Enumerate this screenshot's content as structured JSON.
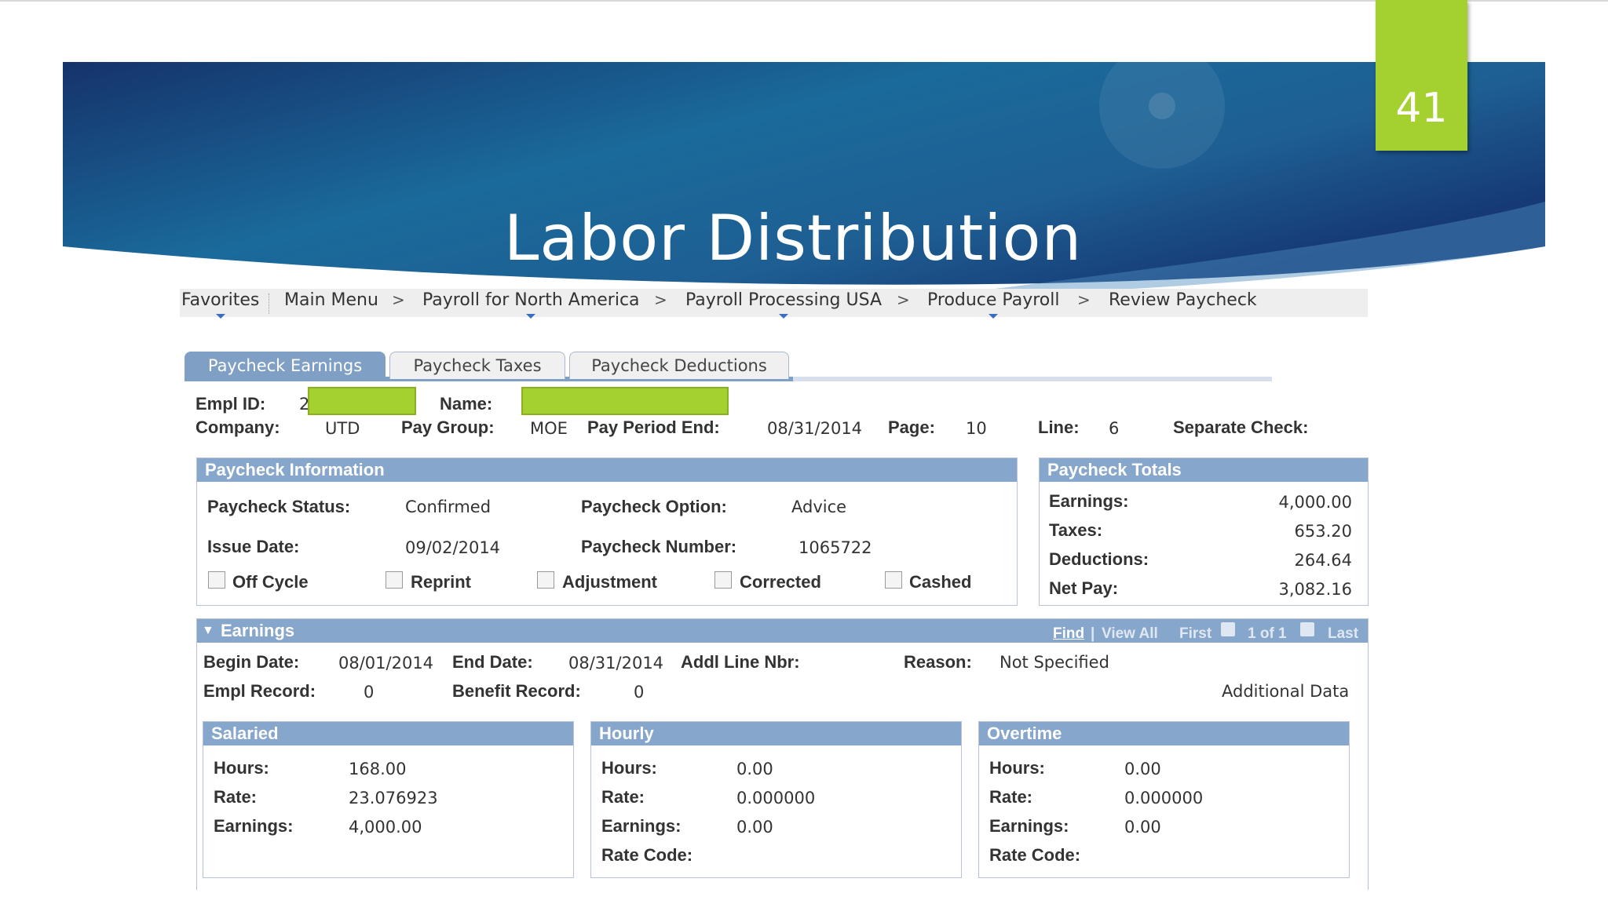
{
  "slide": {
    "title": "Labor Distribution",
    "number": "41"
  },
  "breadcrumb": {
    "items": [
      "Favorites",
      "Main Menu",
      "Payroll for North America",
      "Payroll Processing USA",
      "Produce Payroll",
      "Review Paycheck"
    ],
    "separator": ">"
  },
  "tabs": [
    "Paycheck Earnings",
    "Paycheck Taxes",
    "Paycheck Deductions"
  ],
  "header": {
    "empl_id_label": "Empl ID:",
    "empl_id_value": "2",
    "name_label": "Name:",
    "company_label": "Company:",
    "company_value": "UTD",
    "pay_group_label": "Pay Group:",
    "pay_group_value": "MOE",
    "pay_period_end_label": "Pay Period End:",
    "pay_period_end_value": "08/31/2014",
    "page_label": "Page:",
    "page_value": "10",
    "line_label": "Line:",
    "line_value": "6",
    "separate_check_label": "Separate Check:"
  },
  "paycheck_info": {
    "title": "Paycheck Information",
    "status_label": "Paycheck Status:",
    "status_value": "Confirmed",
    "option_label": "Paycheck Option:",
    "option_value": "Advice",
    "issue_date_label": "Issue Date:",
    "issue_date_value": "09/02/2014",
    "number_label": "Paycheck Number:",
    "number_value": "1065722",
    "checkboxes": [
      "Off Cycle",
      "Reprint",
      "Adjustment",
      "Corrected",
      "Cashed"
    ]
  },
  "totals": {
    "title": "Paycheck Totals",
    "rows": [
      {
        "label": "Earnings:",
        "value": "4,000.00"
      },
      {
        "label": "Taxes:",
        "value": "653.20"
      },
      {
        "label": "Deductions:",
        "value": "264.64"
      },
      {
        "label": "Net Pay:",
        "value": "3,082.16"
      }
    ]
  },
  "earnings": {
    "title": "Earnings",
    "nav": {
      "find": "Find",
      "view_all": "View All",
      "first": "First",
      "position": "1 of 1",
      "last": "Last"
    },
    "begin_date_label": "Begin Date:",
    "begin_date_value": "08/01/2014",
    "end_date_label": "End Date:",
    "end_date_value": "08/31/2014",
    "addl_line_label": "Addl Line Nbr:",
    "reason_label": "Reason:",
    "reason_value": "Not Specified",
    "empl_record_label": "Empl Record:",
    "empl_record_value": "0",
    "benefit_record_label": "Benefit Record:",
    "benefit_record_value": "0",
    "additional_data": "Additional Data"
  },
  "salaried": {
    "title": "Salaried",
    "hours_label": "Hours:",
    "hours": "168.00",
    "rate_label": "Rate:",
    "rate": "23.076923",
    "earnings_label": "Earnings:",
    "earnings": "4,000.00"
  },
  "hourly": {
    "title": "Hourly",
    "hours_label": "Hours:",
    "hours": "0.00",
    "rate_label": "Rate:",
    "rate": "0.000000",
    "earnings_label": "Earnings:",
    "earnings": "0.00",
    "rate_code_label": "Rate Code:"
  },
  "overtime": {
    "title": "Overtime",
    "hours_label": "Hours:",
    "hours": "0.00",
    "rate_label": "Rate:",
    "rate": "0.000000",
    "earnings_label": "Earnings:",
    "earnings": "0.00",
    "rate_code_label": "Rate Code:"
  },
  "colors": {
    "banner_dark": "#14366e",
    "banner_mid": "#1d6d9c",
    "accent_green": "#a4d030",
    "panel_header": "#87a6cb"
  }
}
